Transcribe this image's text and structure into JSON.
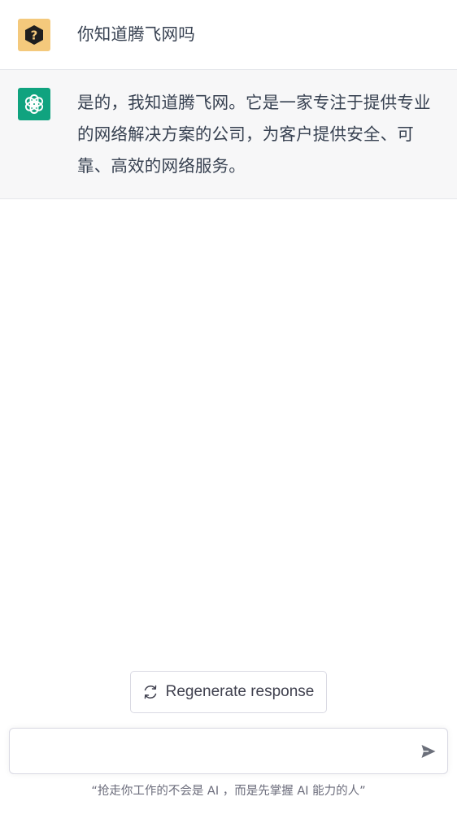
{
  "conversation": {
    "user_message": {
      "text": "你知道腾飞网吗",
      "avatar_icon": "question-mark-icon",
      "avatar_color": "#f4c97c"
    },
    "assistant_message": {
      "text": "是的，我知道腾飞网。它是一家专注于提供专业的网络解决方案的公司，为客户提供安全、可靠、高效的网络服务。",
      "avatar_icon": "openai-logo-icon",
      "avatar_color": "#10a37f"
    }
  },
  "controls": {
    "regenerate_label": "Regenerate response",
    "regenerate_icon": "refresh-icon",
    "input_value": "",
    "send_icon": "send-arrow-icon"
  },
  "footer": {
    "note": "“抢走你工作的不会是 AI ，而是先掌握 AI 能力的人”"
  }
}
